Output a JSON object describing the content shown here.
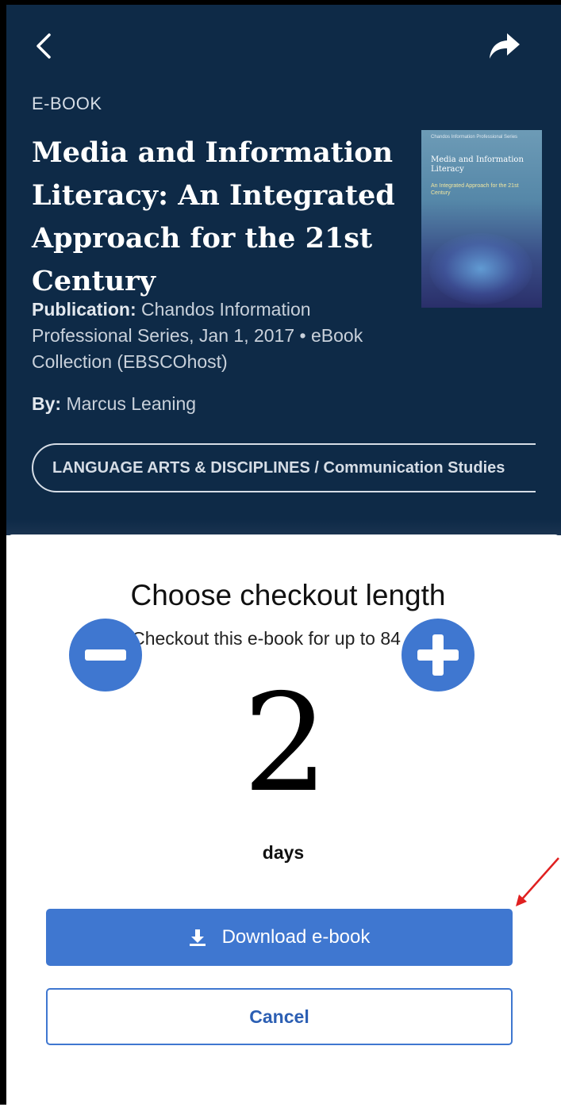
{
  "colors": {
    "header_bg": "#0e2a47",
    "accent": "#3f77d0",
    "annotation": "#e02020"
  },
  "header": {
    "back_icon": "chevron-left-icon",
    "share_icon": "share-arrow-icon",
    "type_label": "E-BOOK",
    "title": "Media and Information Literacy: An Integrated Approach for the 21st Century",
    "publication_label": "Publication:",
    "publication_value": "Chandos Information Professional Series, Jan 1, 2017  •  eBook Collection (EBSCOhost)",
    "by_label": "By:",
    "by_value": "Marcus Leaning",
    "subject_chip": "LANGUAGE ARTS & DISCIPLINES / Communication Studies"
  },
  "cover": {
    "series": "Chandos Information Professional Series",
    "title": "Media and Information Literacy",
    "subtitle": "An Integrated Approach for the 21st Century"
  },
  "checkout": {
    "title": "Choose checkout length",
    "subtitle": "Checkout this e-book for up to 84 days",
    "days_value": "2",
    "days_unit": "days",
    "minus_icon": "minus-circle-icon",
    "plus_icon": "plus-circle-icon",
    "download_icon": "download-icon",
    "download_label": "Download e-book",
    "cancel_label": "Cancel"
  }
}
